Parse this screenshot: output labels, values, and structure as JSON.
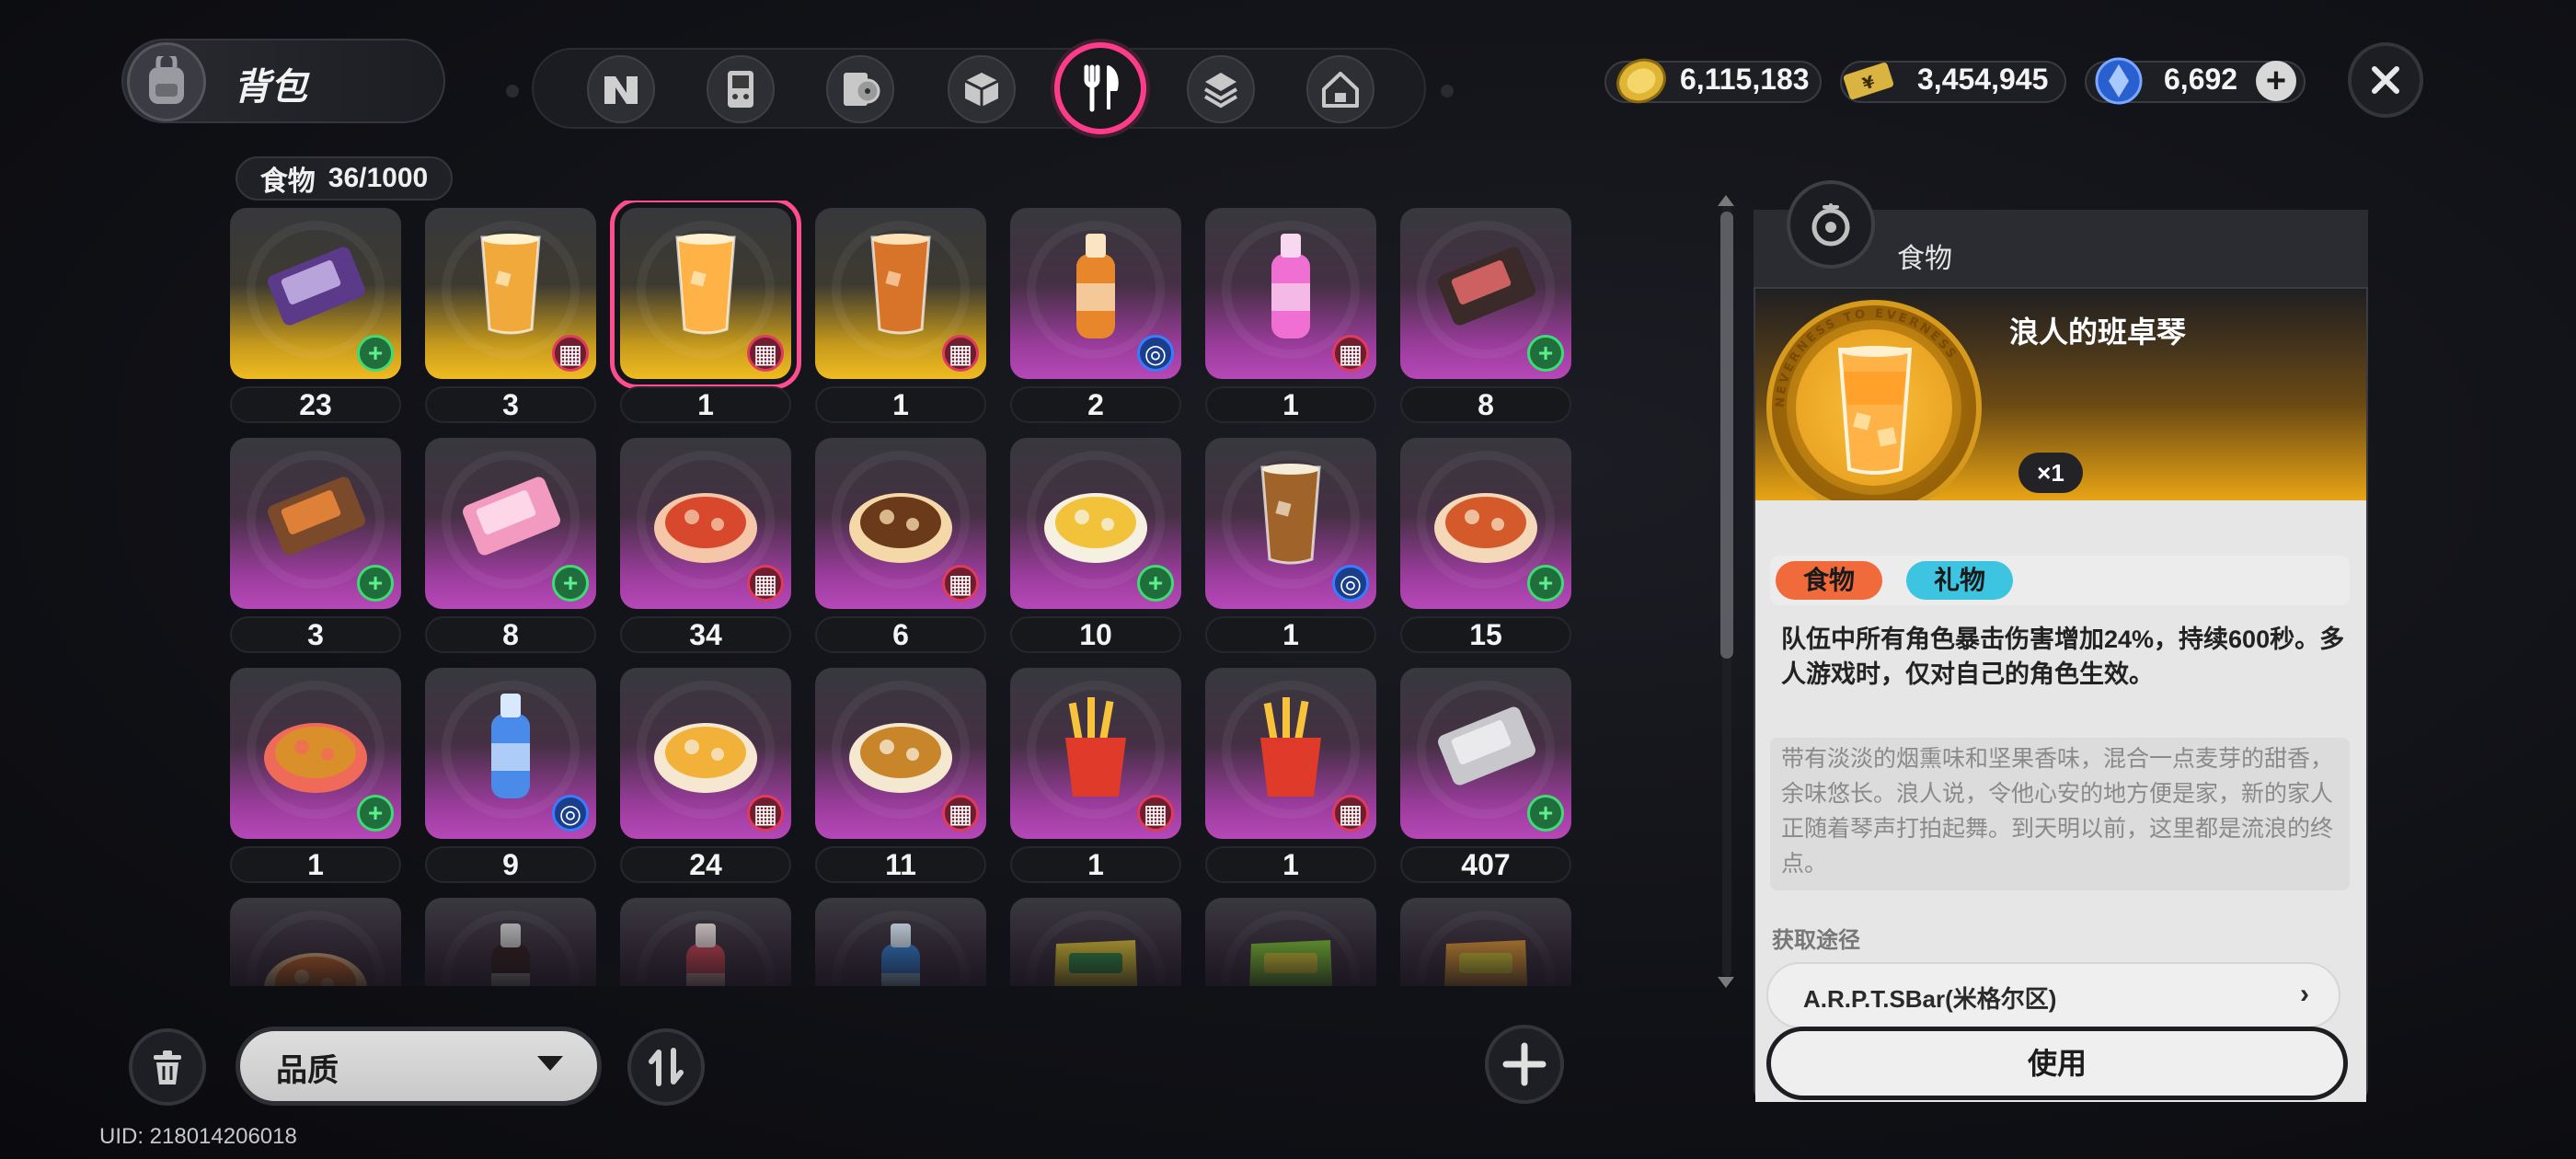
{
  "header": {
    "title": "背包",
    "tabs": [
      {
        "icon": "n-logo-icon",
        "active": false
      },
      {
        "icon": "handheld-device-icon",
        "active": false
      },
      {
        "icon": "record-disc-icon",
        "active": false
      },
      {
        "icon": "cube-box-icon",
        "active": false
      },
      {
        "icon": "fork-knife-icon",
        "active": true
      },
      {
        "icon": "crystal-stack-icon",
        "active": false
      },
      {
        "icon": "home-icon",
        "active": false
      }
    ],
    "currencies": [
      {
        "icon": "gold-coin-icon",
        "value": "6,115,183"
      },
      {
        "icon": "ticket-icon",
        "value": "3,454,945"
      },
      {
        "icon": "blue-crystal-icon",
        "value": "6,692"
      }
    ]
  },
  "inventory": {
    "category": "食物",
    "count": "36/1000",
    "items": [
      {
        "qty": "23",
        "rarity": "gold",
        "badge": "green",
        "art": "chocolate-bar"
      },
      {
        "qty": "3",
        "rarity": "gold",
        "badge": "red",
        "art": "cocktail"
      },
      {
        "qty": "1",
        "rarity": "gold",
        "badge": "red",
        "art": "orange-drink",
        "selected": true
      },
      {
        "qty": "1",
        "rarity": "gold",
        "badge": "red",
        "art": "iced-tea"
      },
      {
        "qty": "2",
        "rarity": "purple",
        "badge": "blue",
        "art": "orange-bottle"
      },
      {
        "qty": "1",
        "rarity": "purple",
        "badge": "red",
        "art": "pink-bottle"
      },
      {
        "qty": "8",
        "rarity": "purple",
        "badge": "green",
        "art": "dark-chocolate"
      },
      {
        "qty": "3",
        "rarity": "purple",
        "badge": "green",
        "art": "chocolate-orange"
      },
      {
        "qty": "8",
        "rarity": "purple",
        "badge": "green",
        "art": "pink-candy"
      },
      {
        "qty": "34",
        "rarity": "purple",
        "badge": "red",
        "art": "ramen"
      },
      {
        "qty": "6",
        "rarity": "purple",
        "badge": "red",
        "art": "sushi-boat"
      },
      {
        "qty": "10",
        "rarity": "purple",
        "badge": "green",
        "art": "curry-plate"
      },
      {
        "qty": "1",
        "rarity": "purple",
        "badge": "blue",
        "art": "iced-coffee"
      },
      {
        "qty": "15",
        "rarity": "purple",
        "badge": "green",
        "art": "noodle-soup"
      },
      {
        "qty": "1",
        "rarity": "purple",
        "badge": "green",
        "art": "pizza"
      },
      {
        "qty": "9",
        "rarity": "purple",
        "badge": "blue",
        "art": "blue-bottle"
      },
      {
        "qty": "24",
        "rarity": "purple",
        "badge": "red",
        "art": "cupcakes"
      },
      {
        "qty": "11",
        "rarity": "purple",
        "badge": "red",
        "art": "takoyaki"
      },
      {
        "qty": "1",
        "rarity": "purple",
        "badge": "red",
        "art": "fries"
      },
      {
        "qty": "1",
        "rarity": "purple",
        "badge": "red",
        "art": "fries"
      },
      {
        "qty": "407",
        "rarity": "purple",
        "badge": "green",
        "art": "pill-pack"
      },
      {
        "qty": "",
        "rarity": "purple",
        "badge": "",
        "art": "lasagna"
      },
      {
        "qty": "",
        "rarity": "purple",
        "badge": "",
        "art": "cola-bottle"
      },
      {
        "qty": "",
        "rarity": "purple",
        "badge": "",
        "art": "red-bottle"
      },
      {
        "qty": "",
        "rarity": "purple",
        "badge": "",
        "art": "blue-bottle-2"
      },
      {
        "qty": "",
        "rarity": "purple",
        "badge": "",
        "art": "chips-yellow"
      },
      {
        "qty": "",
        "rarity": "purple",
        "badge": "",
        "art": "chips-green"
      },
      {
        "qty": "",
        "rarity": "purple",
        "badge": "",
        "art": "chips-orange"
      }
    ]
  },
  "controls": {
    "sort_label": "品质",
    "uid": "UID: 218014206018"
  },
  "detail": {
    "category": "食物",
    "name": "浪人的班卓琴",
    "owned": "×1",
    "tags": [
      "食物",
      "礼物"
    ],
    "effect": "队伍中所有角色暴击伤害增加24%，持续600秒。多人游戏时，仅对自己的角色生效。",
    "flavor": "带有淡淡的烟熏味和坚果香味，混合一点麦芽的甜香，余味悠长。浪人说，令他心安的地方便是家，新的家人正随着琴声打拍起舞。到天明以前，这里都是流浪的终点。",
    "medal_text": "NEVERNESS TO EVERNESS",
    "source_label": "获取途径",
    "source": "A.R.P.T.SBar(米格尔区)",
    "use_label": "使用"
  },
  "colors": {
    "accent": "#ff3c8c",
    "gold": "#f0bc22",
    "purple": "#b648b8",
    "tag_food": "#f06a3c",
    "tag_gift": "#3cc4e0"
  }
}
